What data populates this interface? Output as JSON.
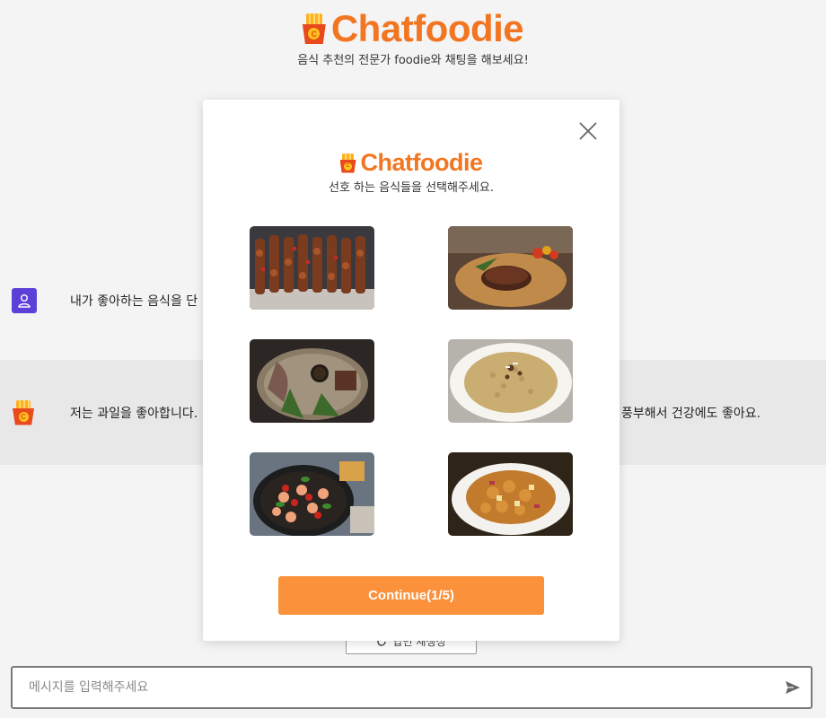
{
  "header": {
    "title": "Chatfoodie",
    "subtitle": "음식 추천의 전문가 foodie와 채팅을 해보세요!",
    "logo_icon": "fries-logo-icon",
    "logo_letter": "C",
    "brand_color": "#f27621"
  },
  "chat": {
    "user_message": "내가 좋아하는 음식을 단",
    "bot_message": "저는 과일을 좋아합니다.",
    "bot_message_tail": "풍부해서 건강에도 좋아요.",
    "user_avatar_icon": "user-icon",
    "user_avatar_color": "#5a3fd8"
  },
  "reset_button": {
    "label": "답변 재생성",
    "icon": "refresh-icon"
  },
  "composer": {
    "placeholder": "메시지를 입력해주세요",
    "send_icon": "send-icon"
  },
  "modal": {
    "title": "Chatfoodie",
    "subtitle": "선호 하는 음식들을 선택해주세요.",
    "close_icon": "close-icon",
    "foods": [
      {
        "name": "kebab-skewers"
      },
      {
        "name": "grilled-steak"
      },
      {
        "name": "sliced-beef-platter"
      },
      {
        "name": "risotto"
      },
      {
        "name": "shrimp-skillet"
      },
      {
        "name": "sweet-and-sour-pork"
      }
    ],
    "continue_label": "Continue(1/5)",
    "button_color": "#fb913a"
  }
}
